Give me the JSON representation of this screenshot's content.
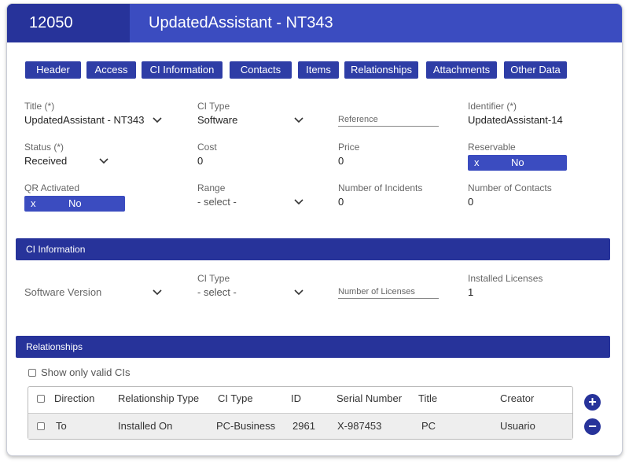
{
  "header": {
    "record_id": "12050",
    "title": "UpdatedAssistant - NT343"
  },
  "tabs": [
    {
      "label": "Header"
    },
    {
      "label": "Access"
    },
    {
      "label": "CI Information"
    },
    {
      "label": "Contacts"
    },
    {
      "label": "Items"
    },
    {
      "label": "Relationships"
    },
    {
      "label": "Attachments"
    },
    {
      "label": "Other Data"
    }
  ],
  "form": {
    "title_label": "Title (*)",
    "title_value": "UpdatedAssistant - NT343",
    "ci_type_label": "CI Type",
    "ci_type_value": "Software",
    "reference_placeholder": "Reference",
    "identifier_label": "Identifier (*)",
    "identifier_value": "UpdatedAssistant-14",
    "status_label": "Status (*)",
    "status_value": "Received",
    "cost_label": "Cost",
    "cost_value": "0",
    "price_label": "Price",
    "price_value": "0",
    "reservable_label": "Reservable",
    "reservable_x": "x",
    "reservable_value": "No",
    "qr_label": "QR Activated",
    "qr_x": "x",
    "qr_value": "No",
    "range_label": "Range",
    "range_value": "-  select -",
    "incidents_label": "Number of Incidents",
    "incidents_value": "0",
    "contacts_label": "Number of Contacts",
    "contacts_value": "0"
  },
  "ci_information": {
    "section_title": "CI Information",
    "software_version_placeholder": "Software Version",
    "ci_type_label": "CI Type",
    "ci_type_value": "-  select -",
    "licenses_placeholder": "Number of Licenses",
    "installed_label": "Installed Licenses",
    "installed_value": "1"
  },
  "relationships": {
    "section_title": "Relationships",
    "filter_label": "Show only valid CIs",
    "columns": [
      "Direction",
      "Relationship Type",
      "CI Type",
      "ID",
      "Serial Number",
      "Title",
      "Creator"
    ],
    "rows": [
      [
        "To",
        "Installed On",
        "PC-Business",
        "2961",
        "X-987453",
        "PC",
        "Usuario"
      ]
    ],
    "add_symbol": "+",
    "remove_symbol": "−"
  },
  "colors": {
    "primary": "#3b4cc0",
    "dark": "#27339a"
  }
}
